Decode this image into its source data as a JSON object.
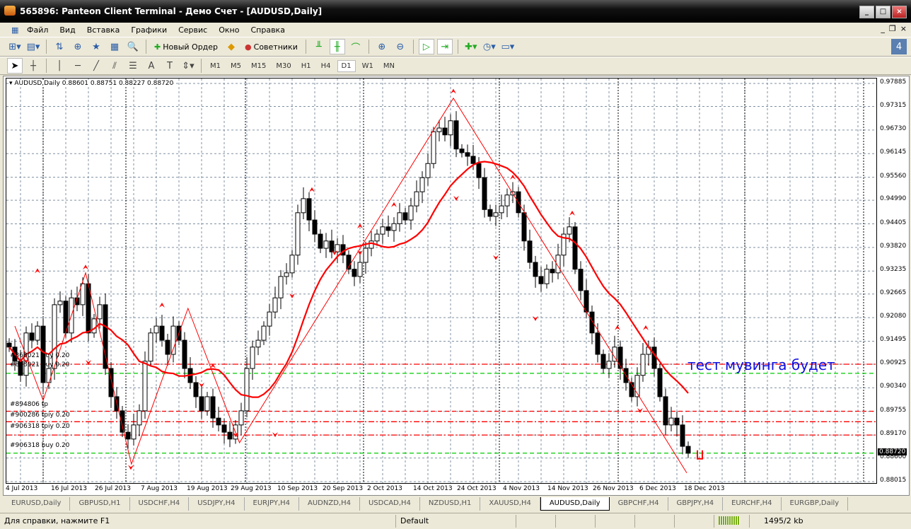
{
  "window": {
    "title": "565896: Panteon Client Terminal - Демо Счет - [AUDUSD,Daily]"
  },
  "menu": [
    "Файл",
    "Вид",
    "Вставка",
    "Графики",
    "Сервис",
    "Окно",
    "Справка"
  ],
  "toolbar": {
    "new_order": "Новый Ордер",
    "experts": "Советники"
  },
  "timeframes": [
    "M1",
    "M5",
    "M15",
    "M30",
    "H1",
    "H4",
    "D1",
    "W1",
    "MN"
  ],
  "active_timeframe": "D1",
  "chart_header": "AUDUSD,Daily  0.88601 0.88751 0.88227 0.88720",
  "price_axis": [
    "0.97885",
    "0.97315",
    "0.96730",
    "0.96145",
    "0.95560",
    "0.94990",
    "0.94405",
    "0.93820",
    "0.93235",
    "0.92665",
    "0.92080",
    "0.91495",
    "0.90925",
    "0.90340",
    "0.89755",
    "0.89170",
    "0.88600",
    "0.88015"
  ],
  "current_price": "0.88720",
  "date_axis": [
    "4 Jul 2013",
    "16 Jul 2013",
    "26 Jul 2013",
    "7 Aug 2013",
    "19 Aug 2013",
    "29 Aug 2013",
    "10 Sep 2013",
    "20 Sep 2013",
    "2 Oct 2013",
    "14 Oct 2013",
    "24 Oct 2013",
    "4 Nov 2013",
    "14 Nov 2013",
    "26 Nov 2013",
    "6 Dec 2013",
    "18 Dec 2013"
  ],
  "order_labels": [
    {
      "text": "#868021 buy 0.20",
      "price": 0.91
    },
    {
      "text": "#868021 buy 0.20",
      "price": 0.9076
    },
    {
      "text": "#894806 tp",
      "price": 0.8979
    },
    {
      "text": "#900286 tpiy 0.20",
      "price": 0.8952
    },
    {
      "text": "#906318 tpiy 0.20",
      "price": 0.8924
    },
    {
      "text": "#906318 buy 0.20",
      "price": 0.8877
    }
  ],
  "order_lines": [
    {
      "price": 0.90925,
      "color": "#ff0000",
      "style": "dashdot"
    },
    {
      "price": 0.907,
      "color": "#00cc00",
      "style": "dash"
    },
    {
      "price": 0.8976,
      "color": "#ff0000",
      "style": "dash"
    },
    {
      "price": 0.895,
      "color": "#ff0000",
      "style": "dashdot"
    },
    {
      "price": 0.8917,
      "color": "#ff0000",
      "style": "dashdot"
    },
    {
      "price": 0.8872,
      "color": "#00cc00",
      "style": "dash"
    }
  ],
  "annotation": "тест мувинга будет",
  "chart_data": {
    "type": "candlestick",
    "symbol": "AUDUSD",
    "timeframe": "Daily",
    "ylim": [
      0.88015,
      0.97885
    ],
    "closes": [
      0.9135,
      0.91,
      0.9065,
      0.917,
      0.9152,
      0.9187,
      0.9047,
      0.9082,
      0.924,
      0.9249,
      0.917,
      0.9257,
      0.924,
      0.9292,
      0.917,
      0.9205,
      0.924,
      0.9082,
      0.9012,
      0.8977,
      0.8924,
      0.8907,
      0.8942,
      0.8977,
      0.91,
      0.917,
      0.9187,
      0.9152,
      0.9117,
      0.9187,
      0.9152,
      0.9082,
      0.9047,
      0.9012,
      0.8977,
      0.9012,
      0.8959,
      0.8942,
      0.8924,
      0.8907,
      0.8942,
      0.8977,
      0.9082,
      0.9135,
      0.9152,
      0.9187,
      0.9222,
      0.9257,
      0.931,
      0.9319,
      0.9363,
      0.9468,
      0.9503,
      0.945,
      0.9415,
      0.938,
      0.9398,
      0.9371,
      0.9389,
      0.9363,
      0.9328,
      0.931,
      0.9345,
      0.938,
      0.9398,
      0.9415,
      0.9433,
      0.9424,
      0.9441,
      0.9468,
      0.945,
      0.9485,
      0.952,
      0.9555,
      0.959,
      0.9669,
      0.9678,
      0.9661,
      0.9696,
      0.9626,
      0.9617,
      0.9608,
      0.959,
      0.9555,
      0.9476,
      0.9459,
      0.9468,
      0.9485,
      0.9512,
      0.952,
      0.9468,
      0.9398,
      0.9345,
      0.931,
      0.9292,
      0.9328,
      0.9319,
      0.9363,
      0.9415,
      0.9433,
      0.9328,
      0.9275,
      0.9222,
      0.917,
      0.9117,
      0.9082,
      0.91,
      0.9135,
      0.9082,
      0.9047,
      0.9012,
      0.9065,
      0.9117,
      0.9135,
      0.9082,
      0.9012,
      0.8942,
      0.8959,
      0.8942,
      0.8889,
      0.8872
    ],
    "ma_period": 14,
    "zigzag": [
      [
        1,
        0.9187
      ],
      [
        6,
        0.9003
      ],
      [
        13.5,
        0.9319
      ],
      [
        21.6,
        0.8845
      ],
      [
        31.6,
        0.9231
      ],
      [
        40.7,
        0.8898
      ],
      [
        78.5,
        0.9752
      ],
      [
        119.75,
        0.8823
      ]
    ],
    "fractals_up": [
      [
        5,
        0.9325
      ],
      [
        13.5,
        0.9334
      ],
      [
        27,
        0.924
      ],
      [
        36,
        0.9089
      ],
      [
        53.5,
        0.9526
      ],
      [
        62,
        0.9436
      ],
      [
        68,
        0.9489
      ],
      [
        78.5,
        0.977
      ],
      [
        89,
        0.9557
      ],
      [
        99.5,
        0.9468
      ],
      [
        107.5,
        0.9184
      ],
      [
        112.5,
        0.9184
      ]
    ],
    "fractals_down": [
      [
        3,
        0.91
      ],
      [
        14,
        0.9096
      ],
      [
        21.5,
        0.8836
      ],
      [
        34,
        0.904
      ],
      [
        40,
        0.8917
      ],
      [
        47,
        0.8917
      ],
      [
        50,
        0.9261
      ],
      [
        57.5,
        0.9368
      ],
      [
        62,
        0.9368
      ],
      [
        79,
        0.9503
      ],
      [
        86,
        0.9356
      ],
      [
        93,
        0.9205
      ],
      [
        111.5,
        0.8977
      ]
    ]
  },
  "tabs": [
    "EURUSD,Daily",
    "GBPUSD,H1",
    "USDCHF,H4",
    "USDJPY,H4",
    "EURJPY,H4",
    "AUDNZD,H4",
    "USDCAD,H4",
    "NZDUSD,H1",
    "XAUUSD,H4",
    "AUDUSD,Daily",
    "GBPCHF,H4",
    "GBPJPY,H4",
    "EURCHF,H4",
    "EURGBP,Daily"
  ],
  "active_tab": "AUDUSD,Daily",
  "status": {
    "help": "Для справки, нажмите F1",
    "profile": "Default",
    "traffic": "1495/2 kb"
  },
  "colors": {
    "bull": "#ffffff",
    "bear": "#000000",
    "ma": "#ff0000",
    "zigzag": "#ff0000",
    "annotation": "#1010e0"
  }
}
